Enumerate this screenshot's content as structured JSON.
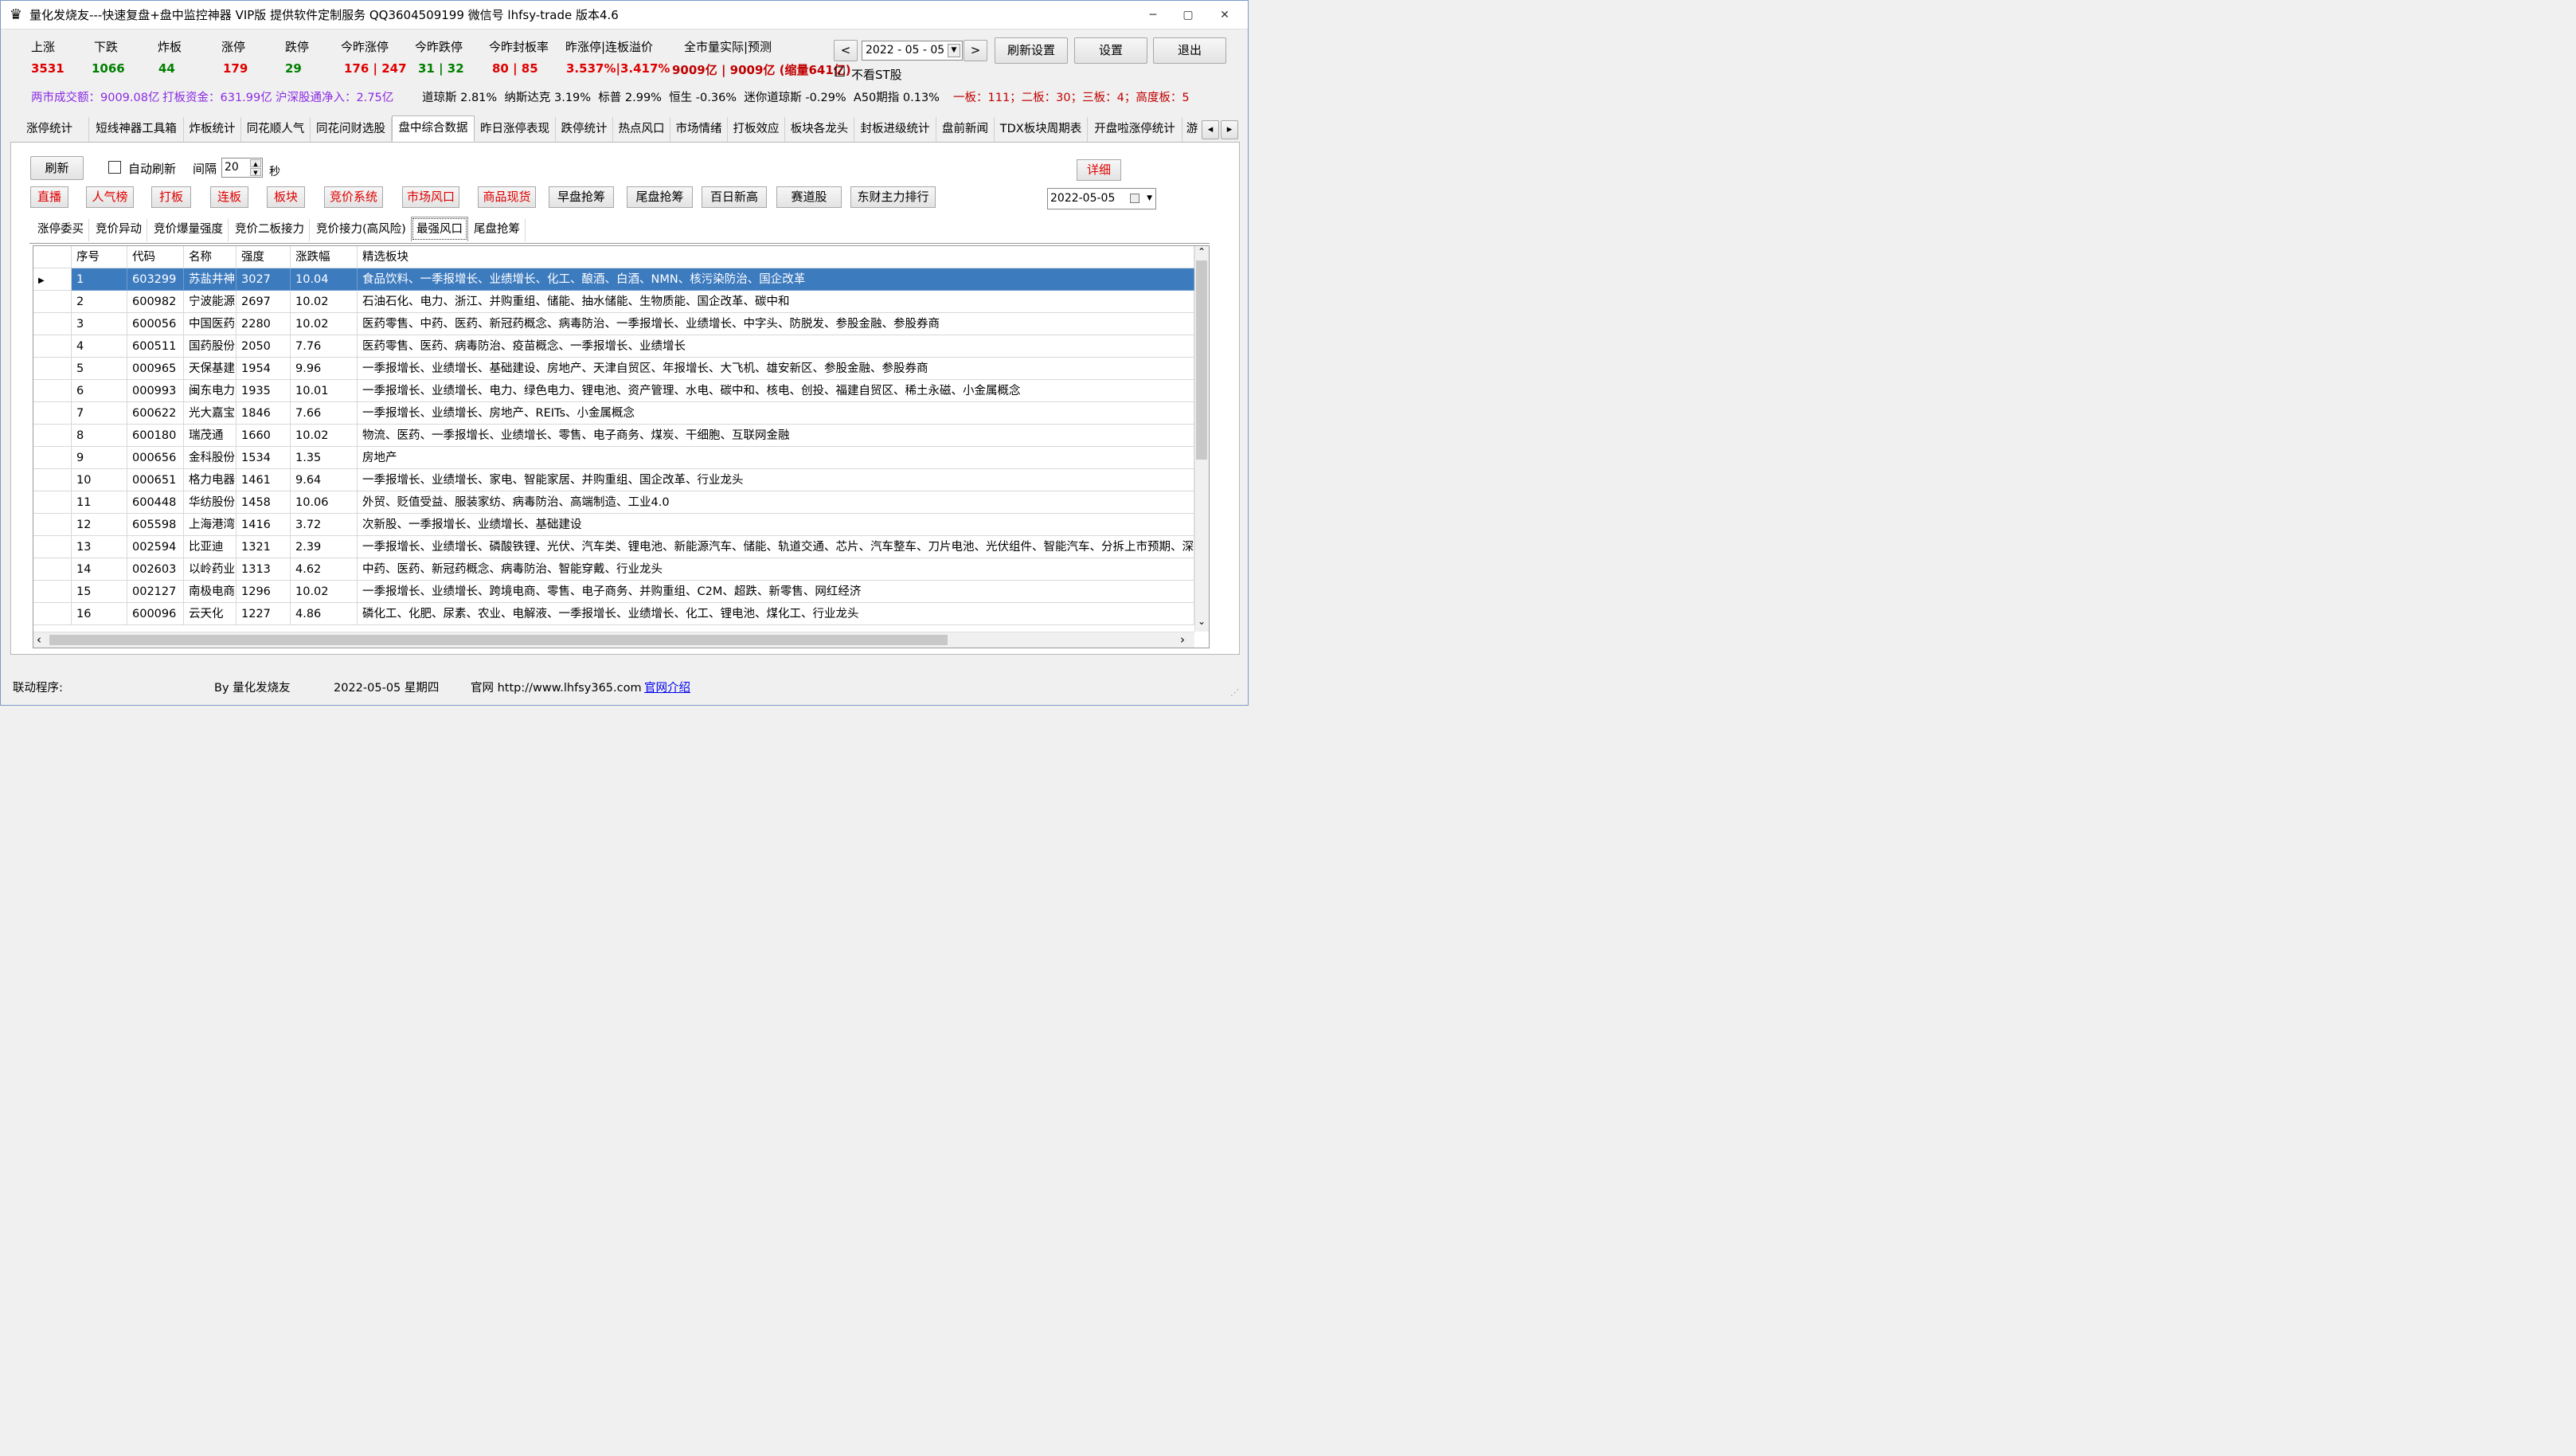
{
  "window": {
    "title": "量化发烧友---快速复盘+盘中监控神器 VIP版  提供软件定制服务 QQ3604509199 微信号 lhfsy-trade  版本4.6",
    "minimize": "─",
    "maximize": "▢",
    "close": "✕",
    "app_icon": "♛"
  },
  "stats": {
    "labels": [
      "上涨",
      "下跌",
      "炸板",
      "涨停",
      "跌停",
      "今昨涨停",
      "今昨跌停",
      "今昨封板率",
      "昨涨停|连板溢价",
      "全市量实际|预测"
    ],
    "values": [
      "3531",
      "1066",
      "44",
      "179",
      "29",
      "176 | 247",
      "31 | 32",
      "80 | 85",
      "3.537%|3.417%",
      "9009亿 | 9009亿 (缩量641亿)"
    ]
  },
  "controls": {
    "prev": "<",
    "next": ">",
    "date": "2022 - 05 - 05",
    "refresh_settings": "刷新设置",
    "settings": "设置",
    "exit": "退出",
    "hide_st_label": "不看ST股",
    "hide_st_checked": "☑"
  },
  "market": {
    "turnover": "两市成交额：9009.08亿",
    "limit_funds": "打板资金：631.99亿",
    "hk_flow": "沪深股通净入：2.75亿",
    "indices": "道琼斯 2.81%  纳斯达克 3.19%  标普 2.99%  恒生 -0.36%  迷你道琼斯 -0.29%  A50期指 0.13%",
    "boards": "一板：111；二板：30；三板：4；高度板：5"
  },
  "tabs": [
    "涨停统计",
    "短线神器工具箱",
    "炸板统计",
    "同花顺人气",
    "同花问财选股",
    "盘中综合数据",
    "昨日涨停表现",
    "跌停统计",
    "热点风口",
    "市场情绪",
    "打板效应",
    "板块各龙头",
    "封板进级统计",
    "盘前新闻",
    "TDX板块周期表",
    "开盘啦涨停统计",
    "游"
  ],
  "tab_arrows": [
    "◂",
    "▸"
  ],
  "panel": {
    "refresh": "刷新",
    "auto_refresh": "自动刷新",
    "interval_label": "间隔",
    "interval_value": "20",
    "seconds": "秒",
    "detail": "详细",
    "red_buttons": [
      "直播",
      "人气榜",
      "打板",
      "连板",
      "板块",
      "竞价系统",
      "市场风口",
      "商品现货"
    ],
    "gray_buttons": [
      "早盘抢筹",
      "尾盘抢筹",
      "百日新高",
      "赛道股",
      "东财主力排行"
    ],
    "date": "2022-05-05",
    "subtabs": [
      "涨停委买",
      "竞价异动",
      "竞价爆量强度",
      "竞价二板接力",
      "竞价接力(高风险)",
      "最强风口",
      "尾盘抢筹"
    ]
  },
  "grid": {
    "headers": [
      "序号",
      "代码",
      "名称",
      "强度",
      "涨跌幅",
      "精选板块"
    ],
    "rows": [
      [
        "1",
        "603299",
        "苏盐井神",
        "3027",
        "10.04",
        "食品饮料、一季报增长、业绩增长、化工、酿酒、白酒、NMN、核污染防治、国企改革"
      ],
      [
        "2",
        "600982",
        "宁波能源",
        "2697",
        "10.02",
        "石油石化、电力、浙江、并购重组、储能、抽水储能、生物质能、国企改革、碳中和"
      ],
      [
        "3",
        "600056",
        "中国医药",
        "2280",
        "10.02",
        "医药零售、中药、医药、新冠药概念、病毒防治、一季报增长、业绩增长、中字头、防脱发、参股金融、参股券商"
      ],
      [
        "4",
        "600511",
        "国药股份",
        "2050",
        "7.76",
        "医药零售、医药、病毒防治、疫苗概念、一季报增长、业绩增长"
      ],
      [
        "5",
        "000965",
        "天保基建",
        "1954",
        "9.96",
        "一季报增长、业绩增长、基础建设、房地产、天津自贸区、年报增长、大飞机、雄安新区、参股金融、参股券商"
      ],
      [
        "6",
        "000993",
        "闽东电力",
        "1935",
        "10.01",
        "一季报增长、业绩增长、电力、绿色电力、锂电池、资产管理、水电、碳中和、核电、创投、福建自贸区、稀土永磁、小金属概念"
      ],
      [
        "7",
        "600622",
        "光大嘉宝",
        "1846",
        "7.66",
        "一季报增长、业绩增长、房地产、REITs、小金属概念"
      ],
      [
        "8",
        "600180",
        "瑞茂通",
        "1660",
        "10.02",
        "物流、医药、一季报增长、业绩增长、零售、电子商务、煤炭、干细胞、互联网金融"
      ],
      [
        "9",
        "000656",
        "金科股份",
        "1534",
        "1.35",
        "房地产"
      ],
      [
        "10",
        "000651",
        "格力电器",
        "1461",
        "9.64",
        "一季报增长、业绩增长、家电、智能家居、并购重组、国企改革、行业龙头"
      ],
      [
        "11",
        "600448",
        "华纺股份",
        "1458",
        "10.06",
        "外贸、贬值受益、服装家纺、病毒防治、高端制造、工业4.0"
      ],
      [
        "12",
        "605598",
        "上海港湾",
        "1416",
        "3.72",
        "次新股、一季报增长、业绩增长、基础建设"
      ],
      [
        "13",
        "002594",
        "比亚迪",
        "1321",
        "2.39",
        "一季报增长、业绩增长、磷酸铁锂、光伏、汽车类、锂电池、新能源汽车、储能、轨道交通、芯片、汽车整车、刀片电池、光伏组件、智能汽车、分拆上市预期、深"
      ],
      [
        "14",
        "002603",
        "以岭药业",
        "1313",
        "4.62",
        "中药、医药、新冠药概念、病毒防治、智能穿戴、行业龙头"
      ],
      [
        "15",
        "002127",
        "南极电商",
        "1296",
        "10.02",
        "一季报增长、业绩增长、跨境电商、零售、电子商务、并购重组、C2M、超跌、新零售、网红经济"
      ],
      [
        "16",
        "600096",
        "云天化",
        "1227",
        "4.86",
        "磷化工、化肥、尿素、农业、电解液、一季报增长、业绩增长、化工、锂电池、煤化工、行业龙头"
      ]
    ],
    "row_marker": "▶",
    "scroll_up": "⌃",
    "scroll_down": "⌄",
    "scroll_left": "‹",
    "scroll_right": "›"
  },
  "status": {
    "linked": "联动程序:",
    "author": "By 量化发烧友",
    "date": "2022-05-05 星期四",
    "site": "官网 http://www.lhfsy365.com",
    "intro": "官网介绍"
  }
}
